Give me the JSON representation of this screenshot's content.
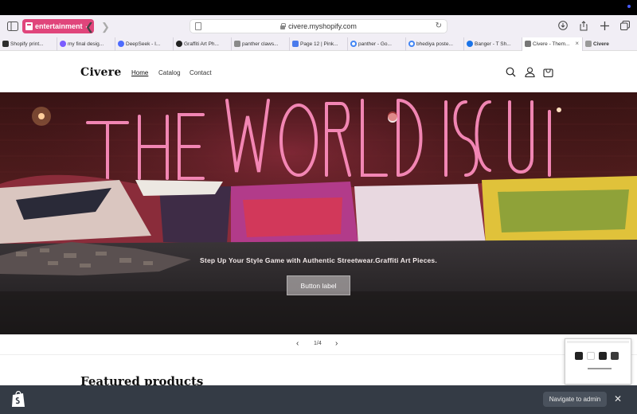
{
  "browser": {
    "tab_group": "entertainment",
    "url": "civere.myshopify.com",
    "tabs": [
      {
        "label": "Shopify print...",
        "color": "#2d2d2d"
      },
      {
        "label": "my final desig...",
        "color": "#7b5cff"
      },
      {
        "label": "DeepSeek - I...",
        "color": "#4d6bfe"
      },
      {
        "label": "Graffiti Art Ph...",
        "color": "#222222"
      },
      {
        "label": "panther claws...",
        "color": "#8a8a8a"
      },
      {
        "label": "Page 12 | Pink...",
        "color": "#4b7bec"
      },
      {
        "label": "panther - Go...",
        "color": "#4285f4"
      },
      {
        "label": "bhediya poste...",
        "color": "#4285f4"
      },
      {
        "label": "Banger - T Sh...",
        "color": "#1a73e8"
      },
      {
        "label": "Civere - Them...",
        "color": "#777777"
      },
      {
        "label": "Civere",
        "color": "#999999"
      }
    ]
  },
  "store": {
    "logo": "Civere",
    "nav": {
      "home": "Home",
      "catalog": "Catalog",
      "contact": "Contact"
    },
    "icons": [
      "search-icon",
      "account-icon",
      "cart-icon"
    ]
  },
  "hero": {
    "tagline": "Step Up Your Style Game with Authentic Streetwear.Graffiti Art Pieces.",
    "button_label": "Button label"
  },
  "slideshow": {
    "counter": "1/4"
  },
  "featured": {
    "title": "Featured products"
  },
  "admin_bar": {
    "navigate_label": "Navigate to admin"
  },
  "colors": {
    "tab_group_pink": "#e0457b",
    "admin_bar_bg": "#343b45",
    "admin_button_bg": "#4a525d"
  }
}
